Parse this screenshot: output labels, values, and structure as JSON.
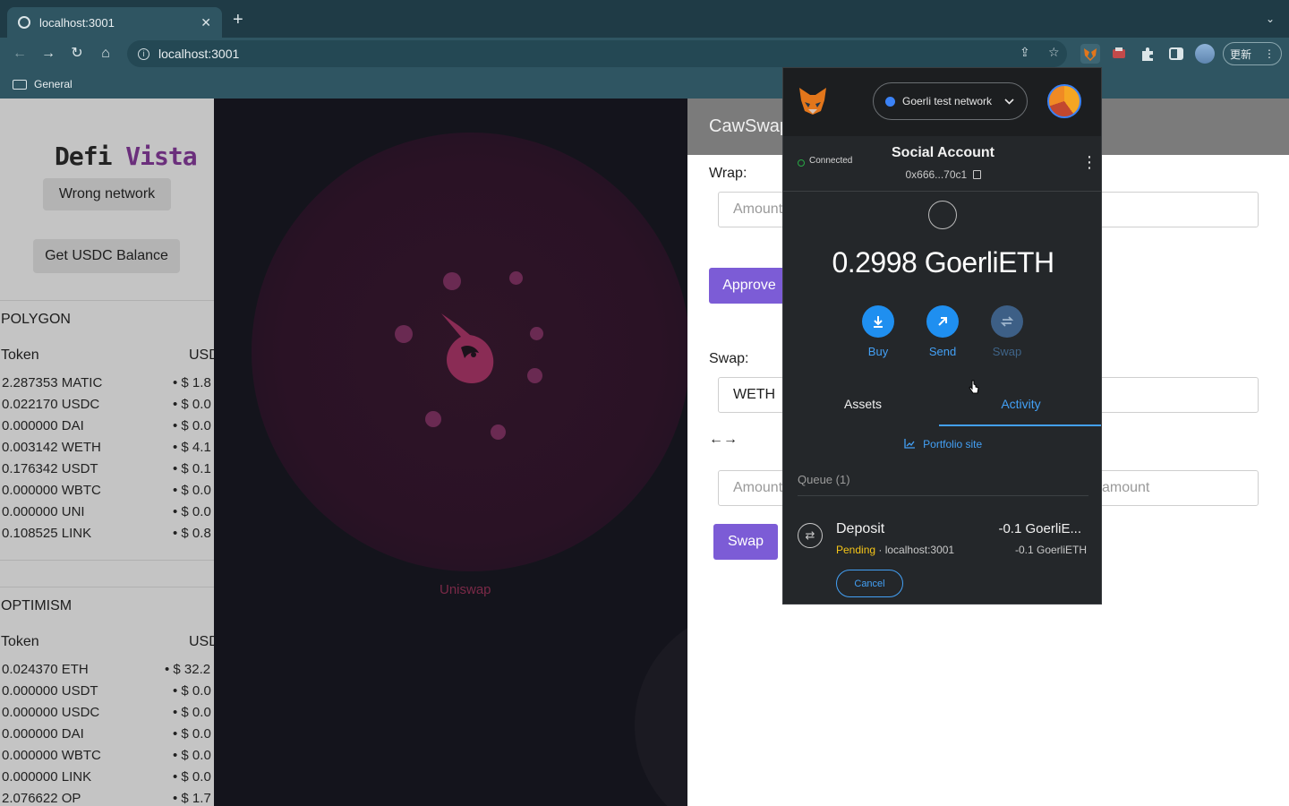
{
  "browser": {
    "tab_title": "localhost:3001",
    "tab_close": "✕",
    "new_tab": "+",
    "url": "localhost:3001",
    "bookmark_folder": "General",
    "update_label": "更新",
    "tab_strip_menu": "⌄",
    "nav": {
      "back": "←",
      "forward": "→",
      "reload": "↻",
      "home": "⌂"
    },
    "omnibox_icons": {
      "share": "⇪",
      "star": "☆"
    },
    "menu": "⋮"
  },
  "left_panel": {
    "brand_part1": "Defi",
    "brand_part2": "Vista",
    "network_status": "Wrong network",
    "balance_button": "Get USDC Balance",
    "sections": [
      {
        "title": "POLYGON",
        "col_token": "Token",
        "col_usd": "USD",
        "rows": [
          {
            "token": "2.287353 MATIC",
            "usd": "• $ 1.8"
          },
          {
            "token": "0.022170 USDC",
            "usd": "• $ 0.0"
          },
          {
            "token": "0.000000 DAI",
            "usd": "• $ 0.0"
          },
          {
            "token": "0.003142 WETH",
            "usd": "• $ 4.1"
          },
          {
            "token": "0.176342 USDT",
            "usd": "• $ 0.1"
          },
          {
            "token": "0.000000 WBTC",
            "usd": "• $ 0.0"
          },
          {
            "token": "0.000000 UNI",
            "usd": "• $ 0.0"
          },
          {
            "token": "0.108525 LINK",
            "usd": "• $ 0.8"
          }
        ]
      },
      {
        "title": "OPTIMISM",
        "col_token": "Token",
        "col_usd": "USD",
        "rows": [
          {
            "token": "0.024370 ETH",
            "usd": "• $ 32.2"
          },
          {
            "token": "0.000000 USDT",
            "usd": "• $ 0.0"
          },
          {
            "token": "0.000000 USDC",
            "usd": "• $ 0.0"
          },
          {
            "token": "0.000000 DAI",
            "usd": "• $ 0.0"
          },
          {
            "token": "0.000000 WBTC",
            "usd": "• $ 0.0"
          },
          {
            "token": "0.000000 LINK",
            "usd": "• $ 0.0"
          },
          {
            "token": "2.076622 OP",
            "usd": "• $ 1.7"
          }
        ]
      }
    ]
  },
  "uniswap": {
    "label": "Uniswap"
  },
  "cawswap": {
    "title": "CawSwap",
    "wrap_label": "Wrap:",
    "amount_placeholder": "Amount",
    "approve_button": "Approve",
    "swap_label": "Swap:",
    "swap_token": "WETH",
    "arrows": "←→",
    "amount_placeholder_right": "amount",
    "swap_button": "Swap"
  },
  "metamask": {
    "network": "Goerli test network",
    "connected": "Connected",
    "account_name": "Social Account",
    "account_address": "0x666...70c1",
    "balance": "0.2998 GoerliETH",
    "actions": {
      "buy": "Buy",
      "send": "Send",
      "swap": "Swap"
    },
    "tabs": {
      "assets": "Assets",
      "activity": "Activity"
    },
    "portfolio_link": "Portfolio site",
    "queue_label": "Queue (1)",
    "tx": {
      "title": "Deposit",
      "status": "Pending",
      "separator": " · ",
      "origin": "localhost:3001",
      "amount": "-0.1 GoerliE...",
      "amount_secondary": "-0.1 GoerliETH",
      "cancel": "Cancel"
    }
  },
  "colors": {
    "brand_accent": "#6b2f7c",
    "metamask_blue": "#43a0f5",
    "pending_yellow": "#f5c518",
    "cawswap_purple": "#7c5cd6"
  }
}
